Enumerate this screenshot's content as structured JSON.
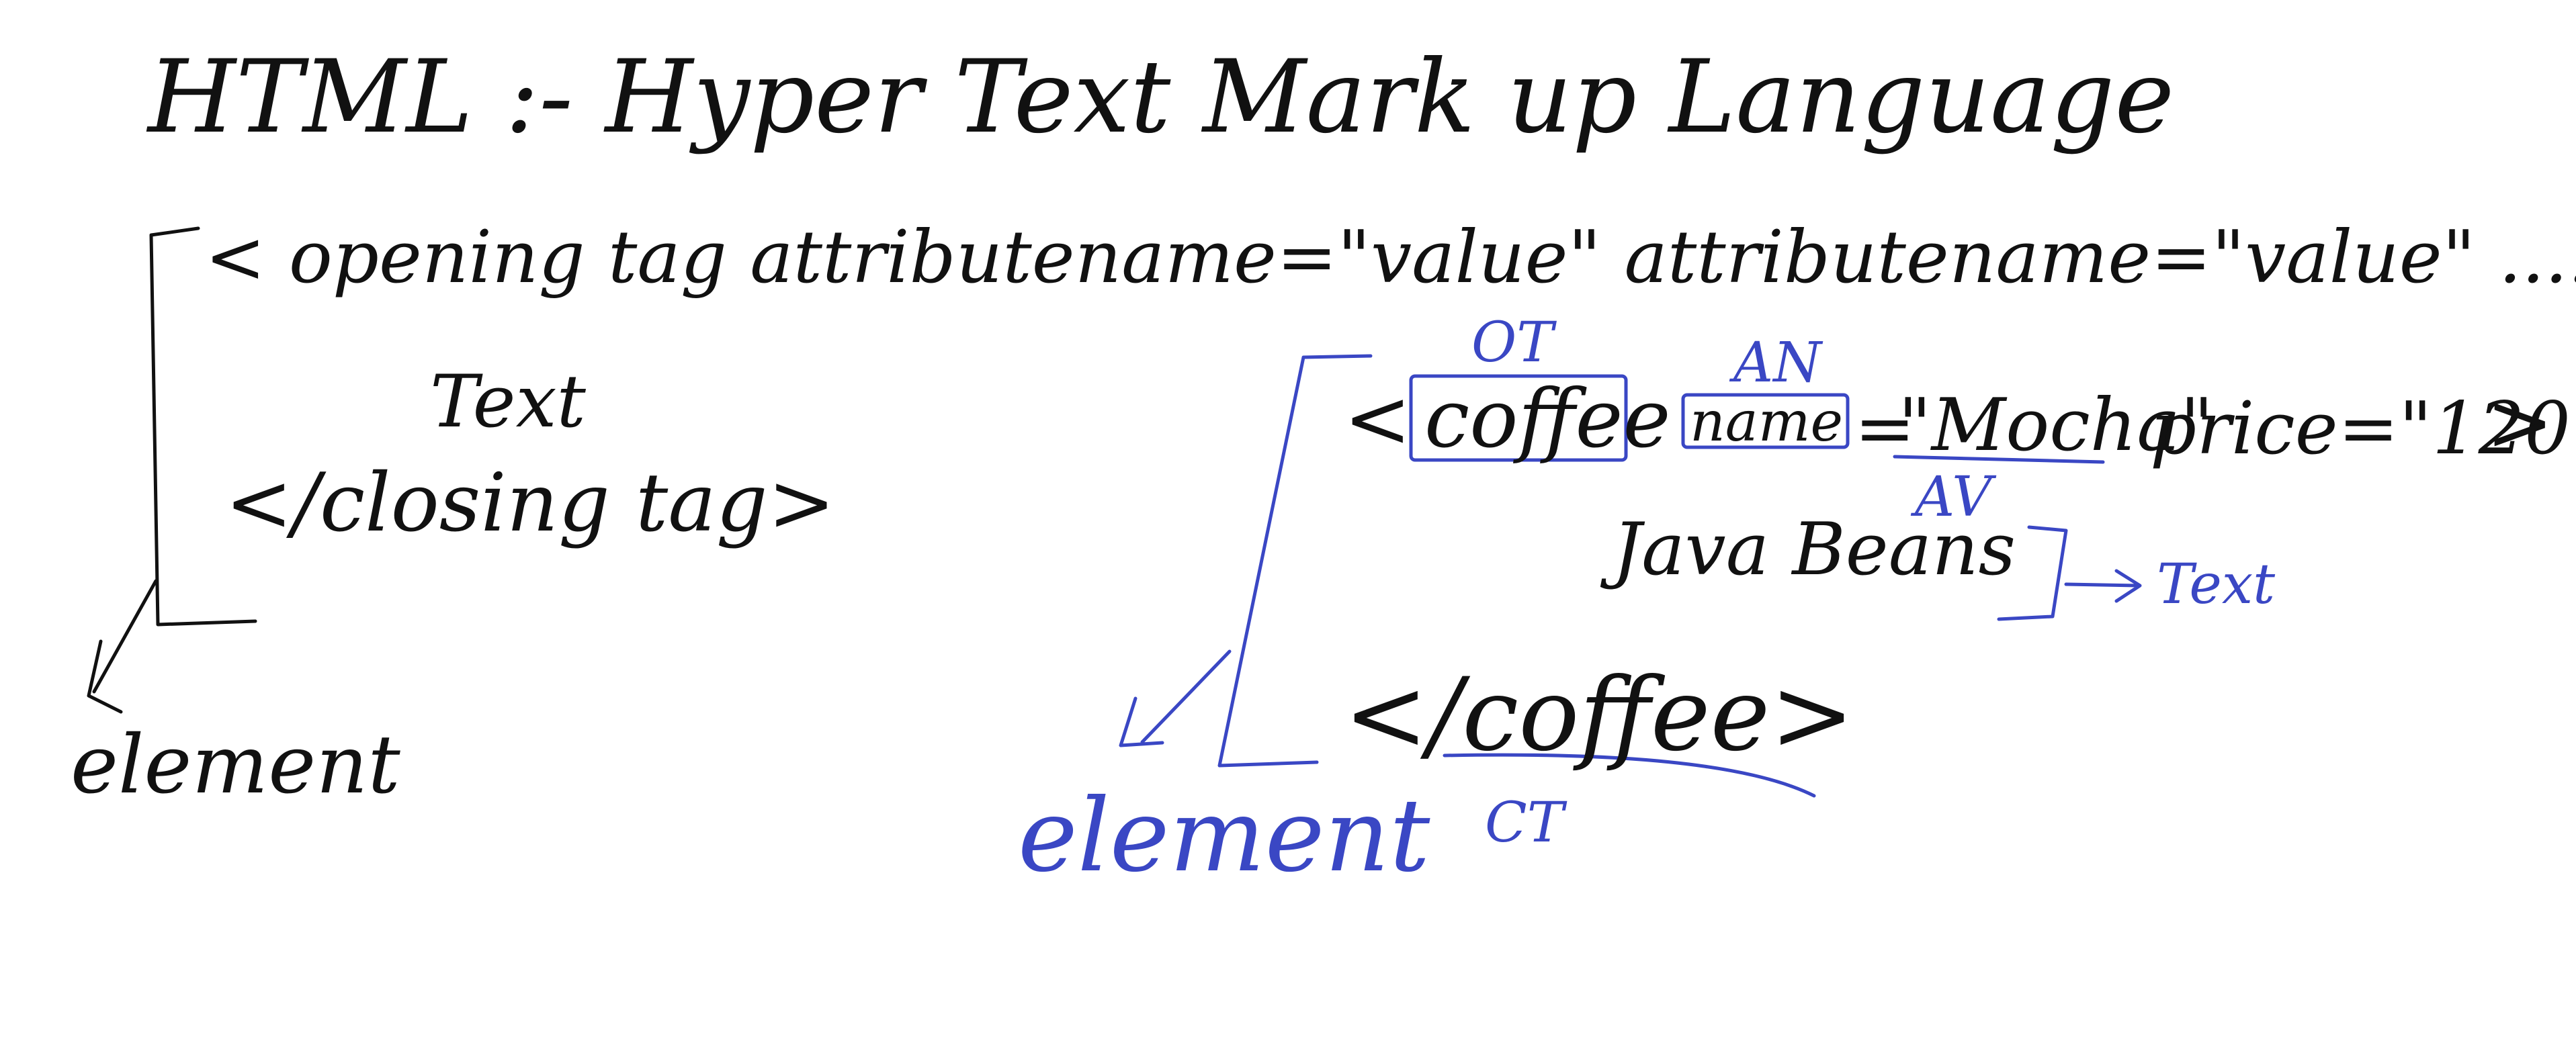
{
  "colors": {
    "ink": "#111111",
    "annotation": "#3a47c4",
    "background": "#ffffff"
  },
  "title": "HTML :- Hyper Text Mark up Language",
  "syntax": {
    "opening": "< opening tag attributename=\"value\" attributename=\"value\" .... >",
    "text": "Text",
    "closing": "</closing tag>",
    "element_label": "element"
  },
  "example": {
    "open_bracket": "<",
    "tag": "coffee",
    "attr_name": "name",
    "equals": "=",
    "attr_value": "\"Mocha\"",
    "attr2": "price=\"120\"",
    "close_bracket": ">",
    "text": "Java Beans",
    "closing": "</coffee>"
  },
  "annotations": {
    "ot": "OT",
    "an": "AN",
    "av": "AV",
    "text": "Text",
    "ct": "CT",
    "element": "element"
  }
}
